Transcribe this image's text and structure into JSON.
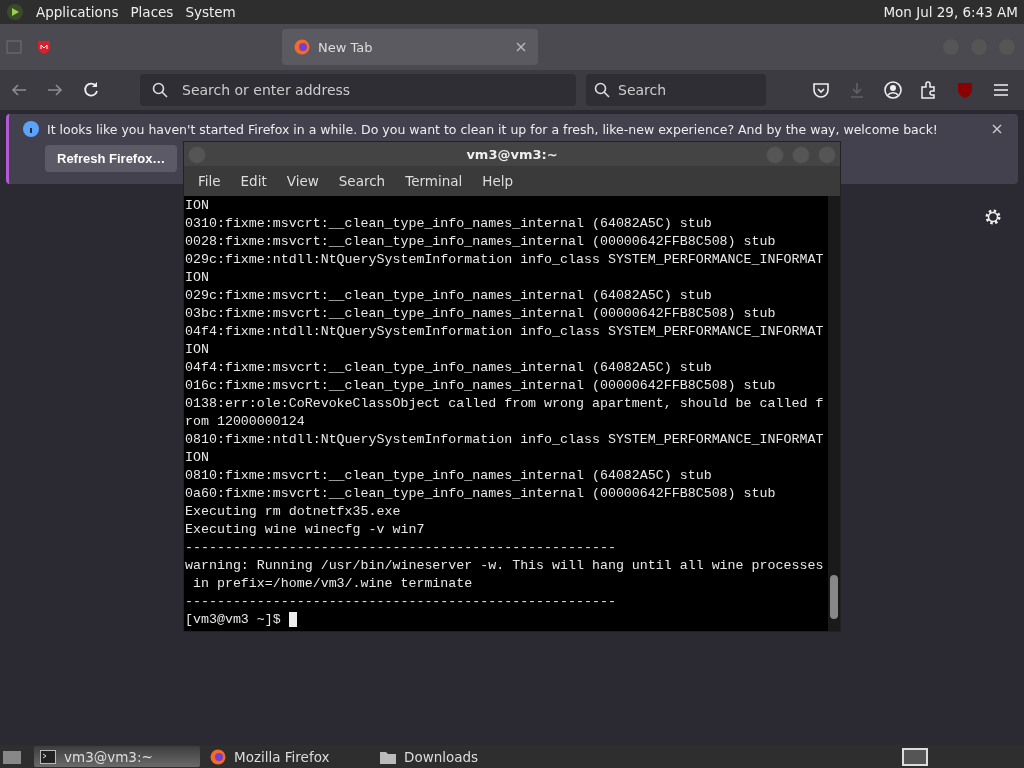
{
  "top_panel": {
    "menus": [
      "Applications",
      "Places",
      "System"
    ],
    "clock": "Mon Jul 29, 6:43 AM"
  },
  "browser": {
    "tabs": [
      {
        "selected": false
      },
      {
        "title": "New Tab",
        "selected": true
      }
    ],
    "address_bar": {
      "placeholder": "Search or enter address"
    },
    "search_bar": {
      "placeholder": "Search"
    },
    "notification": {
      "message": "It looks like you haven't started Firefox in a while. Do you want to clean it up for a fresh, like-new experience? And by the way, welcome back!",
      "button": "Refresh Firefox…"
    }
  },
  "terminal": {
    "title": "vm3@vm3:~",
    "menu": [
      "File",
      "Edit",
      "View",
      "Search",
      "Terminal",
      "Help"
    ],
    "lines": [
      "ION",
      "0310:fixme:msvcrt:__clean_type_info_names_internal (64082A5C) stub",
      "0028:fixme:msvcrt:__clean_type_info_names_internal (00000642FFB8C508) stub",
      "029c:fixme:ntdll:NtQuerySystemInformation info_class SYSTEM_PERFORMANCE_INFORMAT",
      "ION",
      "029c:fixme:msvcrt:__clean_type_info_names_internal (64082A5C) stub",
      "03bc:fixme:msvcrt:__clean_type_info_names_internal (00000642FFB8C508) stub",
      "04f4:fixme:ntdll:NtQuerySystemInformation info_class SYSTEM_PERFORMANCE_INFORMAT",
      "ION",
      "04f4:fixme:msvcrt:__clean_type_info_names_internal (64082A5C) stub",
      "016c:fixme:msvcrt:__clean_type_info_names_internal (00000642FFB8C508) stub",
      "0138:err:ole:CoRevokeClassObject called from wrong apartment, should be called f",
      "rom 12000000124",
      "0810:fixme:ntdll:NtQuerySystemInformation info_class SYSTEM_PERFORMANCE_INFORMAT",
      "ION",
      "0810:fixme:msvcrt:__clean_type_info_names_internal (64082A5C) stub",
      "0a60:fixme:msvcrt:__clean_type_info_names_internal (00000642FFB8C508) stub",
      "Executing rm dotnetfx35.exe",
      "Executing wine winecfg -v win7",
      "------------------------------------------------------",
      "warning: Running /usr/bin/wineserver -w. This will hang until all wine processes",
      " in prefix=/home/vm3/.wine terminate",
      "------------------------------------------------------"
    ],
    "prompt": "[vm3@vm3 ~]$"
  },
  "taskbar": {
    "items": [
      {
        "label": "vm3@vm3:~",
        "kind": "terminal",
        "selected": true
      },
      {
        "label": "Mozilla Firefox",
        "kind": "firefox",
        "selected": false
      },
      {
        "label": "Downloads",
        "kind": "folder",
        "selected": false
      }
    ]
  }
}
